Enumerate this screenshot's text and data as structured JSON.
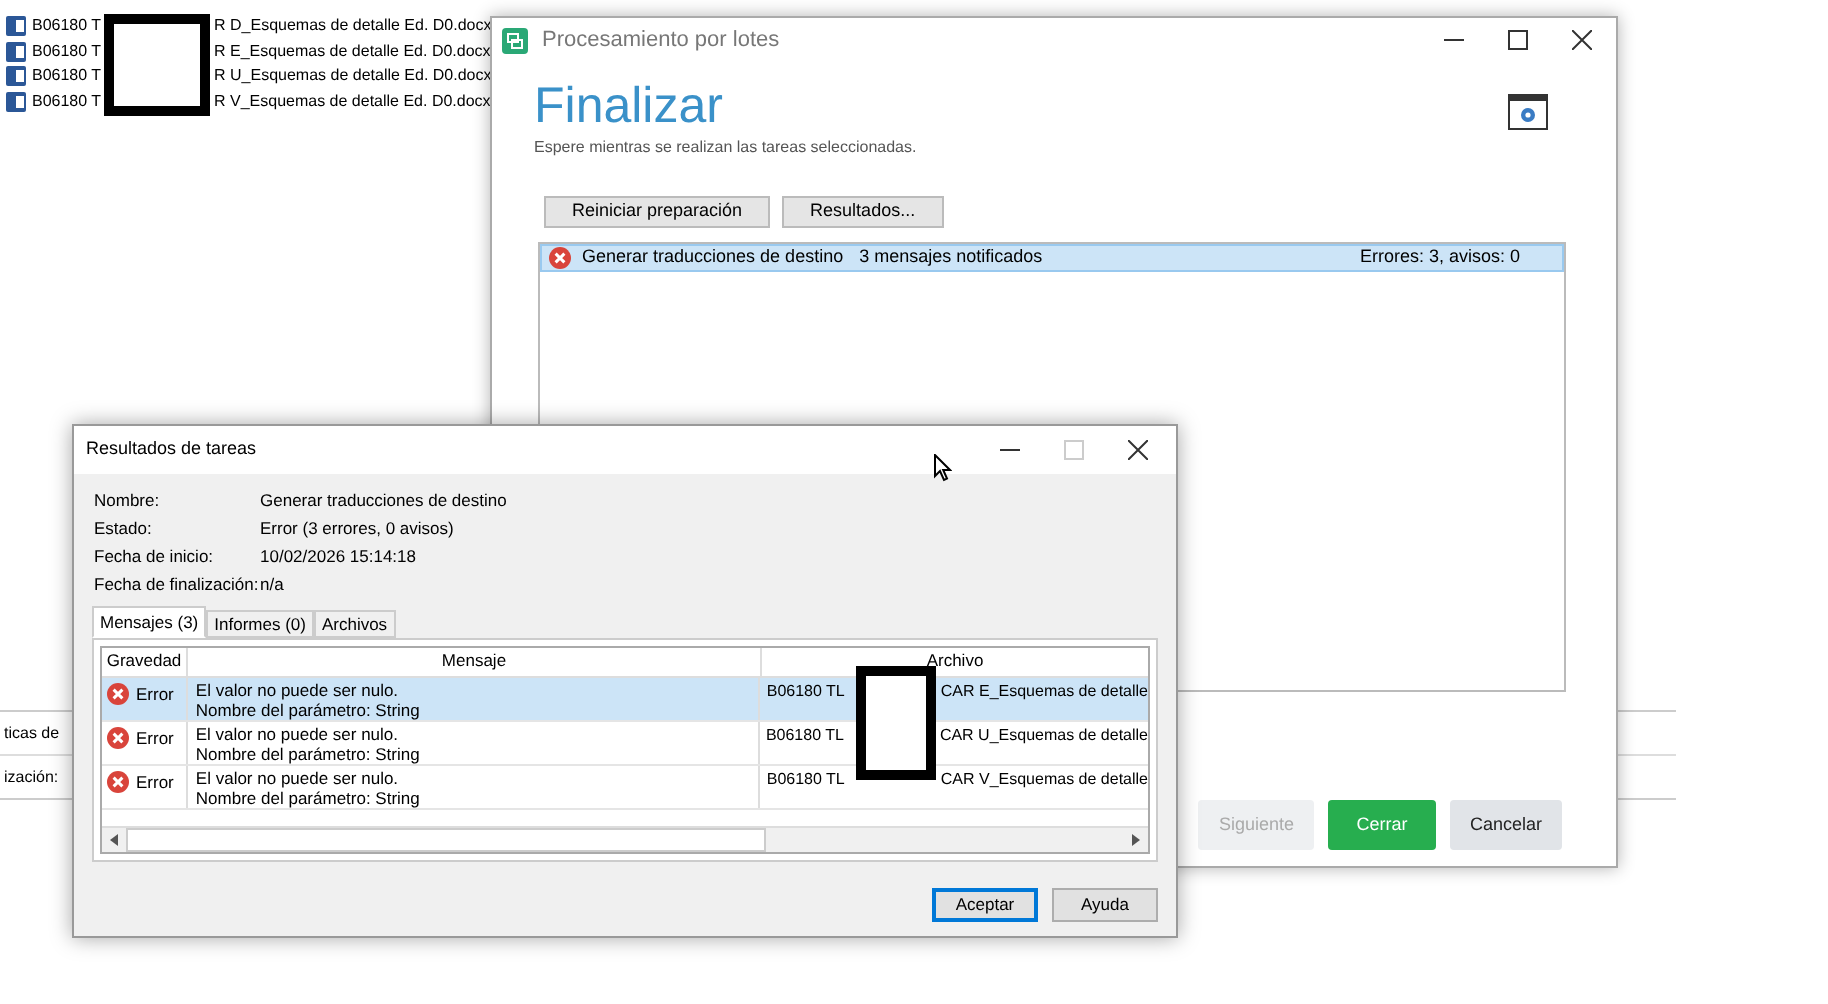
{
  "background_list": {
    "rows": [
      {
        "name_start": "B06180 T",
        "name_end": "R D_Esquemas de detalle Ed. D0.docx"
      },
      {
        "name_start": "B06180 T",
        "name_end": "R E_Esquemas de detalle Ed. D0.docx"
      },
      {
        "name_start": "B06180 T",
        "name_end": "R U_Esquemas de detalle Ed. D0.docx"
      },
      {
        "name_start": "B06180 T",
        "name_end": "R V_Esquemas de detalle Ed. D0.docx"
      }
    ],
    "labels": [
      "ticas de",
      "ización:"
    ]
  },
  "batch_window": {
    "title": "Procesamiento por lotes",
    "heading": "Finalizar",
    "subtitle": "Espere mientras se realizan las tareas seleccionadas.",
    "actions": [
      "Reiniciar preparación",
      "Resultados..."
    ],
    "tasks": [
      {
        "name": "Generar traducciones de destino",
        "messages": "3 mensajes notificados",
        "summary": "Errores: 3, avisos: 0",
        "selected": true
      }
    ],
    "buttons": [
      {
        "label": "Siguiente",
        "disabled": true,
        "primary": false
      },
      {
        "label": "Cerrar",
        "disabled": false,
        "primary": true
      },
      {
        "label": "Cancelar",
        "disabled": false,
        "primary": false
      }
    ]
  },
  "results_dialog": {
    "title": "Resultados de tareas",
    "fields": [
      {
        "label": "Nombre:",
        "value": "Generar traducciones de destino"
      },
      {
        "label": "Estado:",
        "value": "Error (3 errores, 0 avisos)"
      },
      {
        "label": "Fecha de inicio:",
        "value": "10/02/2026 15:14:18"
      },
      {
        "label": "Fecha de finalización:",
        "value": "n/a"
      }
    ],
    "tabs": [
      {
        "label": "Mensajes (3)",
        "selected": true
      },
      {
        "label": "Informes (0)",
        "selected": false
      },
      {
        "label": "Archivos",
        "selected": false
      }
    ],
    "table": {
      "columns": [
        "Gravedad",
        "Mensaje",
        "Archivo"
      ],
      "rows": [
        {
          "severity": "Error",
          "message": [
            "El valor no puede ser nulo.",
            "Nombre del parámetro: String"
          ],
          "file_start": "B06180 TL",
          "file_end": "CAR E_Esquemas de detalle",
          "selected": true
        },
        {
          "severity": "Error",
          "message": [
            "El valor no puede ser nulo.",
            "Nombre del parámetro: String"
          ],
          "file_start": "B06180 TL",
          "file_end": "CAR U_Esquemas de detalle",
          "selected": false
        },
        {
          "severity": "Error",
          "message": [
            "El valor no puede ser nulo.",
            "Nombre del parámetro: String"
          ],
          "file_start": "B06180 TL",
          "file_end": "CAR V_Esquemas de detalle",
          "selected": false
        }
      ]
    },
    "buttons": [
      {
        "label": "Aceptar",
        "default": true
      },
      {
        "label": "Ayuda",
        "default": false
      }
    ]
  }
}
